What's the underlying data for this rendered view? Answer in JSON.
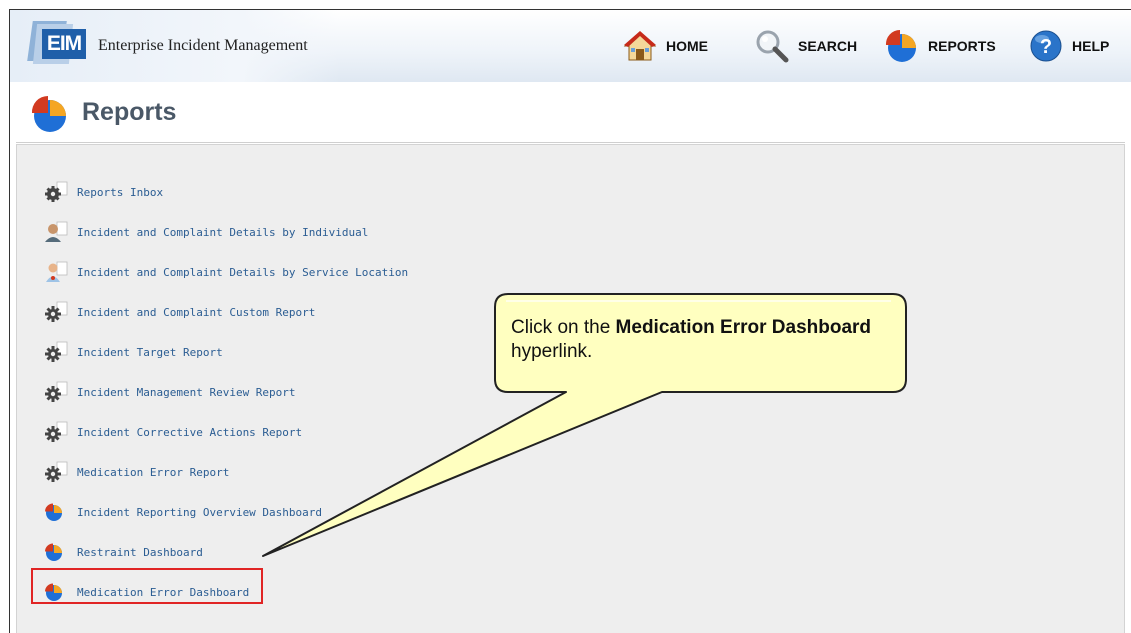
{
  "app": {
    "logo_text": "EIM",
    "title": "Enterprise Incident Management"
  },
  "nav": {
    "home": "HOME",
    "search": "SEARCH",
    "reports": "REPORTS",
    "help": "HELP"
  },
  "page": {
    "title": "Reports"
  },
  "reports": [
    {
      "label": "Reports Inbox",
      "icon": "gear-icon"
    },
    {
      "label": "Incident and Complaint Details by Individual",
      "icon": "person-icon"
    },
    {
      "label": "Incident and Complaint Details by Service Location",
      "icon": "location-person-icon"
    },
    {
      "label": "Incident and Complaint Custom Report",
      "icon": "gear-icon"
    },
    {
      "label": "Incident Target Report",
      "icon": "gear-icon"
    },
    {
      "label": "Incident Management Review Report",
      "icon": "gear-icon"
    },
    {
      "label": "Incident Corrective Actions Report",
      "icon": "gear-icon"
    },
    {
      "label": "Medication Error Report",
      "icon": "gear-icon"
    },
    {
      "label": "Incident Reporting Overview Dashboard",
      "icon": "pie-chart-icon"
    },
    {
      "label": "Restraint Dashboard",
      "icon": "pie-chart-icon"
    },
    {
      "label": "Medication Error Dashboard",
      "icon": "pie-chart-icon"
    }
  ],
  "callout": {
    "part1": "Click on the ",
    "bold": "Medication Error Dashboard",
    "part2": " hyperlink."
  },
  "colors": {
    "link": "#2b5d93",
    "highlight_border": "#e02424",
    "callout_fill": "#ffffc0",
    "brand_blue": "#1f5fa9"
  }
}
